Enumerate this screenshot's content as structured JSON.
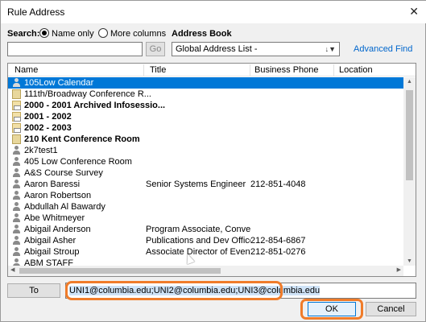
{
  "window": {
    "title": "Rule Address",
    "close_glyph": "✕"
  },
  "search": {
    "label": "Search:",
    "options": [
      "Name only",
      "More columns"
    ],
    "selected": "Name only",
    "value": "",
    "go_label": "Go"
  },
  "address_book": {
    "label": "Address Book",
    "selected": "Global Address List -",
    "advanced_find": "Advanced Find"
  },
  "columns": [
    "Name",
    "Title",
    "Business Phone",
    "Location"
  ],
  "rows": [
    {
      "name": "105Low Calendar",
      "title": "",
      "phone": "",
      "icon": "person-icon",
      "bold": false,
      "selected": true
    },
    {
      "name": "111th/Broadway Conference R...",
      "title": "",
      "phone": "",
      "icon": "room-icon",
      "bold": false,
      "selected": false
    },
    {
      "name": "2000 - 2001 Archived Infosessio...",
      "title": "",
      "phone": "",
      "icon": "group-icon",
      "bold": true,
      "selected": false
    },
    {
      "name": "2001 - 2002",
      "title": "",
      "phone": "",
      "icon": "group-icon",
      "bold": true,
      "selected": false
    },
    {
      "name": "2002 - 2003",
      "title": "",
      "phone": "",
      "icon": "group-icon",
      "bold": true,
      "selected": false
    },
    {
      "name": "210 Kent Conference Room",
      "title": "",
      "phone": "",
      "icon": "room-icon",
      "bold": true,
      "selected": false
    },
    {
      "name": "2k7test1",
      "title": "",
      "phone": "",
      "icon": "person-icon",
      "bold": false,
      "selected": false
    },
    {
      "name": "405 Low Conference Room",
      "title": "",
      "phone": "",
      "icon": "person-icon",
      "bold": false,
      "selected": false
    },
    {
      "name": "A&S Course Survey",
      "title": "",
      "phone": "",
      "icon": "person-icon",
      "bold": false,
      "selected": false
    },
    {
      "name": "Aaron Baressi",
      "title": "Senior Systems Engineer",
      "phone": "212-851-4048",
      "icon": "person-icon",
      "bold": false,
      "selected": false
    },
    {
      "name": "Aaron Robertson",
      "title": "",
      "phone": "",
      "icon": "person-icon",
      "bold": false,
      "selected": false
    },
    {
      "name": "Abdullah Al Bawardy",
      "title": "",
      "phone": "",
      "icon": "person-icon",
      "bold": false,
      "selected": false
    },
    {
      "name": "Abe Whitmeyer",
      "title": "",
      "phone": "",
      "icon": "person-icon",
      "bold": false,
      "selected": false
    },
    {
      "name": "Abigail Anderson",
      "title": "Program Associate, Conve...",
      "phone": "",
      "icon": "person-icon",
      "bold": false,
      "selected": false
    },
    {
      "name": "Abigail Asher",
      "title": "Publications and Dev Officer",
      "phone": "212-854-6867",
      "icon": "person-icon",
      "bold": false,
      "selected": false
    },
    {
      "name": "Abigail Stroup",
      "title": "Associate Director of Event...",
      "phone": "212-851-0276",
      "icon": "person-icon",
      "bold": false,
      "selected": false
    },
    {
      "name": "ABM STAFF",
      "title": "",
      "phone": "",
      "icon": "person-icon",
      "bold": false,
      "selected": false
    }
  ],
  "to": {
    "label": "To",
    "value": "UNI1@columbia.edu;UNI2@columbia.edu;UNI3@columbia.edu"
  },
  "buttons": {
    "ok": "OK",
    "cancel": "Cancel"
  },
  "colors": {
    "selection": "#0078d7",
    "highlight": "#f07c2a",
    "link": "#0066cc"
  }
}
